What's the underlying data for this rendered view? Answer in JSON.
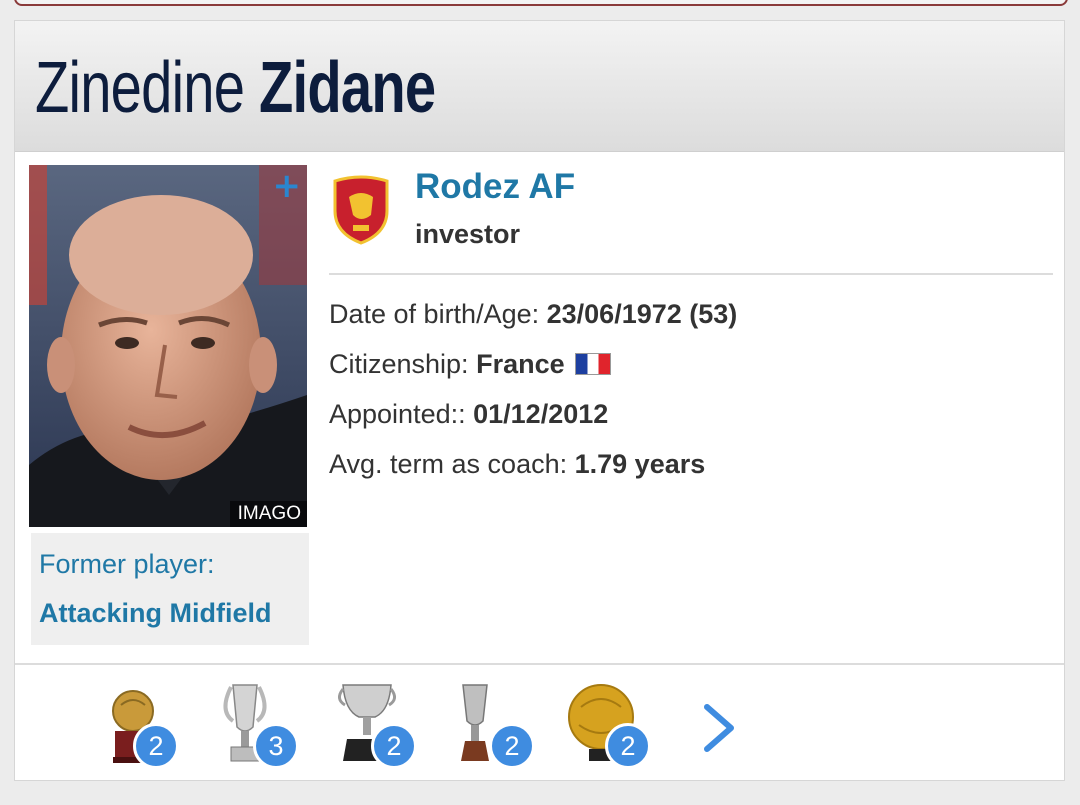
{
  "profile": {
    "first_name": "Zinedine",
    "last_name": "Zidane",
    "photo_credit": "IMAGO",
    "position_label": "Former player:",
    "position_value": "Attacking Midfield"
  },
  "club": {
    "name": "Rodez AF",
    "role": "investor",
    "logo_icon": "rodez-af-crest-icon"
  },
  "details": [
    {
      "label": "Date of birth/Age: ",
      "value": "23/06/1972 (53)"
    },
    {
      "label": "Citizenship: ",
      "value": "France"
    },
    {
      "label": "Appointed:: ",
      "value": "01/12/2012"
    },
    {
      "label": "Avg. term as coach: ",
      "value": "1.79 years"
    }
  ],
  "trophies": [
    {
      "icon": "ballon-dor-trophy-icon",
      "count": "2"
    },
    {
      "icon": "champions-league-trophy-icon",
      "count": "3"
    },
    {
      "icon": "laliga-trophy-icon",
      "count": "2"
    },
    {
      "icon": "super-cup-trophy-icon",
      "count": "2"
    },
    {
      "icon": "golden-ball-trophy-icon",
      "count": "2"
    }
  ],
  "colors": {
    "accent": "#1f78a6",
    "badge": "#3f8ce0",
    "header_text": "#0d1d3d",
    "flag_blue": "#1d3fa0",
    "flag_red": "#e0242c"
  }
}
